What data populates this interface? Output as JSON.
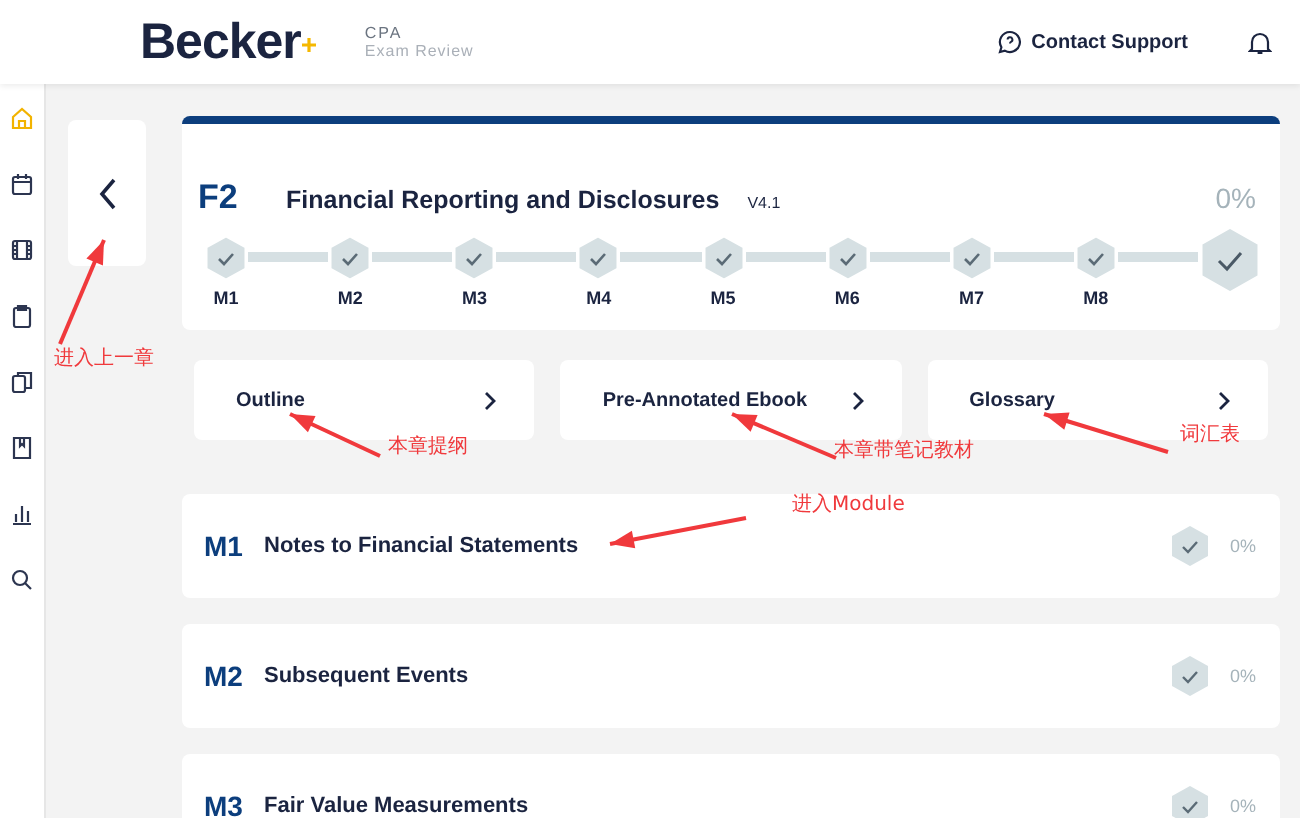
{
  "header": {
    "logo": "Becker",
    "product": "CPA",
    "product_sub": "Exam Review",
    "support": "Contact Support"
  },
  "sidebar": {
    "items": [
      {
        "selected": true
      },
      {
        "selected": false
      },
      {
        "selected": false
      },
      {
        "selected": false
      },
      {
        "selected": false
      },
      {
        "selected": false
      },
      {
        "selected": false
      },
      {
        "selected": false
      }
    ]
  },
  "chapter": {
    "code": "F2",
    "title": "Financial Reporting and Disclosures",
    "version": "V4.1",
    "progress": "0%",
    "completed": false,
    "steps": [
      {
        "label": "M1"
      },
      {
        "label": "M2"
      },
      {
        "label": "M3"
      },
      {
        "label": "M4"
      },
      {
        "label": "M5"
      },
      {
        "label": "M6"
      },
      {
        "label": "M7"
      },
      {
        "label": "M8"
      }
    ]
  },
  "links": [
    {
      "label": "Outline"
    },
    {
      "label": "Pre-Annotated Ebook"
    },
    {
      "label": "Glossary"
    }
  ],
  "modules": [
    {
      "code": "M1",
      "title": "Notes to Financial Statements",
      "progress": "0%",
      "completed": false
    },
    {
      "code": "M2",
      "title": "Subsequent Events",
      "progress": "0%",
      "completed": false
    },
    {
      "code": "M3",
      "title": "Fair Value Measurements",
      "progress": "0%",
      "completed": false
    }
  ],
  "annotations": [
    {
      "text": "进入上一章"
    },
    {
      "text": "本章提纲"
    },
    {
      "text": "本章带笔记教材"
    },
    {
      "text": "词汇表"
    },
    {
      "text": "进入Module"
    }
  ]
}
